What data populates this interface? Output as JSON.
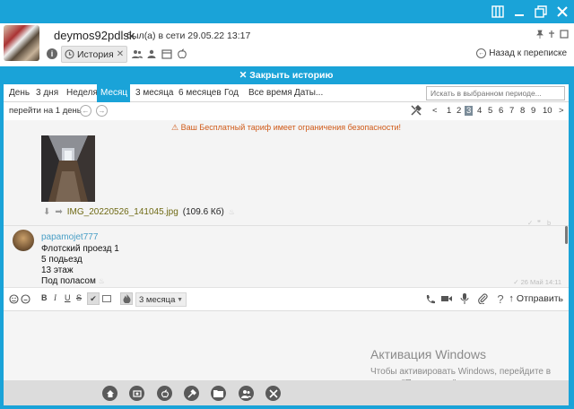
{
  "contact": {
    "name": "deymos92pdlsk",
    "status": "был(а) в сети 29.05.22 13:17"
  },
  "tabs": {
    "history_label": "История"
  },
  "header": {
    "back_label": "Назад к переписке"
  },
  "close_history_label": "✕ Закрыть историю",
  "periods": {
    "items": [
      "День",
      "3 дня",
      "Неделя",
      "Месяц",
      "3 месяца",
      "6 месяцев",
      "Год",
      "Все время",
      "Даты..."
    ],
    "active": "Месяц",
    "search_placeholder": "Искать в выбранном периоде..."
  },
  "navigation": {
    "jump_label": "перейти на 1 день",
    "pages": [
      "<",
      "1",
      "2",
      "3",
      "4",
      "5",
      "6",
      "7",
      "8",
      "9",
      "10",
      ">"
    ],
    "current_page": "3"
  },
  "history": {
    "warning": "Ваш Бесплатный тариф имеет ограничения безопасности!",
    "file": {
      "name": "IMG_20220526_141045.jpg",
      "size": "(109.6 Кб)"
    },
    "message": {
      "sender": "papamojet777",
      "lines": [
        "Флотский проезд 1",
        "5 подьезд",
        "13 этаж",
        "Под поласом"
      ],
      "time": "26 Май 14:11"
    }
  },
  "compose": {
    "range_value": "3 месяца",
    "send_label": "Отправить"
  },
  "watermark": {
    "title": "Активация Windows",
    "subtitle": "Чтобы активировать Windows, перейдите в раздел \"Параметры\"."
  },
  "colors": {
    "accent": "#1aa3d8",
    "file_link": "#6f6a15",
    "sender": "#4a9fc6",
    "warning": "#d05b1a"
  },
  "icons": [
    "panel-icon",
    "minimize-icon",
    "restore-icon",
    "close-icon",
    "pin-icon",
    "info-icon",
    "history-icon",
    "home-icon",
    "gallery-icon",
    "apple-icon",
    "wrench-icon",
    "folder-icon",
    "contacts-icon",
    "settings-icon"
  ]
}
